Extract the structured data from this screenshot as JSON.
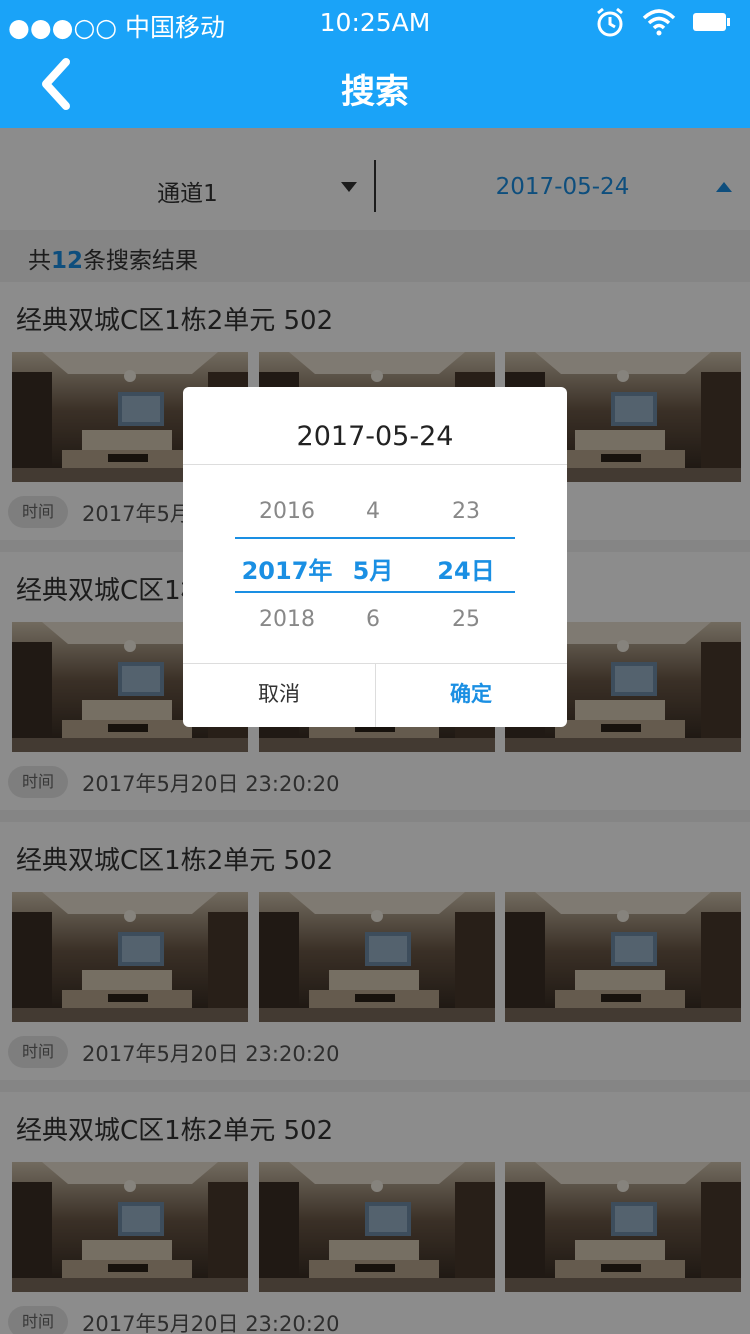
{
  "status_bar": {
    "carrier": "●●●○○ 中国移动",
    "time": "10:25AM",
    "icons": [
      "alarm-icon",
      "wifi-icon",
      "battery-icon"
    ]
  },
  "nav": {
    "back_icon": "chevron-left-icon",
    "title": "搜索"
  },
  "filters": {
    "channel": "通道1",
    "date": "2017-05-24"
  },
  "results": {
    "prefix": "共",
    "count": "12",
    "suffix": "条搜索结果"
  },
  "cards": [
    {
      "name": "经典双城C区1栋2单元 502",
      "tag": "时间",
      "time": "2017年5月20日 23:20:20"
    },
    {
      "name": "经典双城C区1栋2单元 502",
      "tag": "时间",
      "time": "2017年5月20日 23:20:20"
    },
    {
      "name": "经典双城C区1栋2单元 502",
      "tag": "时间",
      "time": "2017年5月20日 23:20:20"
    },
    {
      "name": "经典双城C区1栋2单元 502",
      "tag": "时间",
      "time": "2017年5月20日 23:20:20"
    }
  ],
  "dialog": {
    "title": "2017-05-24",
    "year": {
      "prev": "2016",
      "selected": "2017年",
      "next": "2018"
    },
    "month": {
      "prev": "4",
      "selected": "5月",
      "next": "6"
    },
    "day": {
      "prev": "23",
      "selected": "24日",
      "next": "25"
    },
    "cancel_label": "取消",
    "confirm_label": "确定"
  },
  "colors": {
    "accent": "#1aa3f8",
    "selected_text": "#1a8fe3",
    "overlay": "rgba(0,0,0,0.45)"
  }
}
